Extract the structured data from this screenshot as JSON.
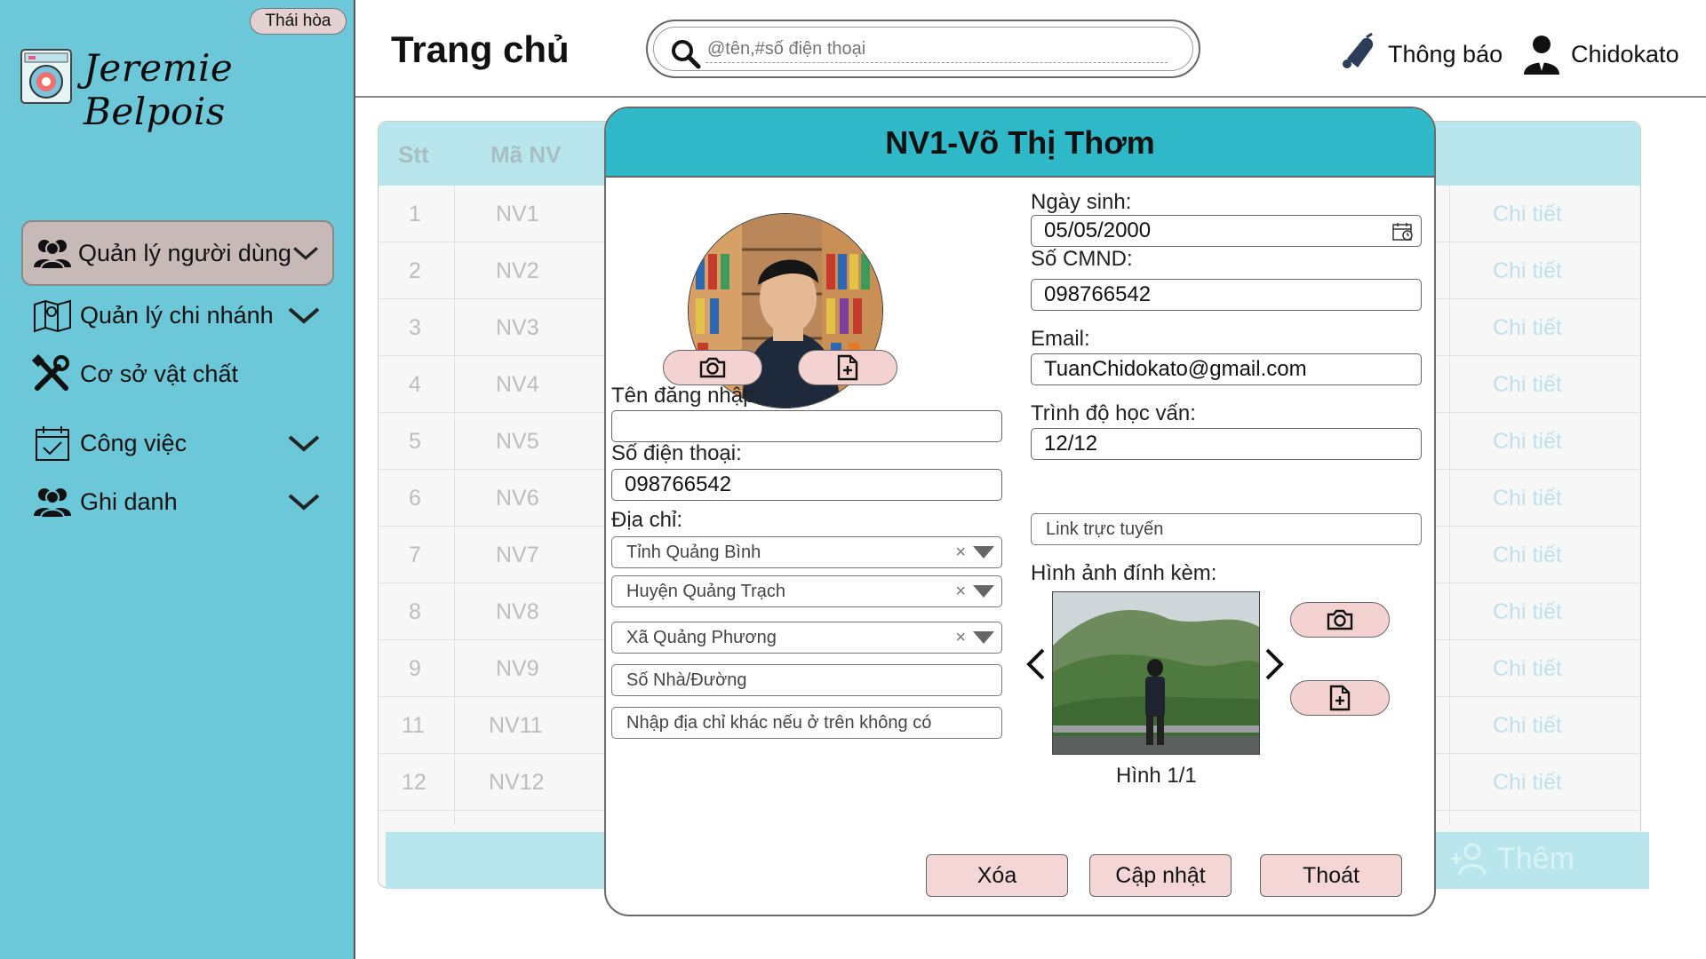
{
  "sidebar": {
    "branch_badge": "Thái hòa",
    "brand_name": "Jeremie Belpois",
    "items": [
      {
        "label": "Quản lý người dùng",
        "icon": "users-icon",
        "active": true
      },
      {
        "label": "Quản lý chi nhánh",
        "icon": "map-icon",
        "active": false
      },
      {
        "label": "Cơ sở vật chất",
        "icon": "tools-icon",
        "active": false
      },
      {
        "label": "Công việc",
        "icon": "calendar-check-icon",
        "active": false
      },
      {
        "label": "Ghi danh",
        "icon": "users-icon",
        "active": false
      }
    ]
  },
  "header": {
    "title": "Trang chủ",
    "search_placeholder": "@tên,#số điện thoại",
    "notifications_label": "Thông báo",
    "user_name": "Chidokato"
  },
  "table": {
    "columns": [
      "Stt",
      "Mã NV"
    ],
    "detail_label": "Chi tiết",
    "rows": [
      {
        "stt": "1",
        "code": "NV1"
      },
      {
        "stt": "2",
        "code": "NV2"
      },
      {
        "stt": "3",
        "code": "NV3"
      },
      {
        "stt": "4",
        "code": "NV4"
      },
      {
        "stt": "5",
        "code": "NV5"
      },
      {
        "stt": "6",
        "code": "NV6"
      },
      {
        "stt": "7",
        "code": "NV7"
      },
      {
        "stt": "8",
        "code": "NV8"
      },
      {
        "stt": "9",
        "code": "NV9"
      },
      {
        "stt": "11",
        "code": "NV11"
      },
      {
        "stt": "12",
        "code": "NV12"
      }
    ],
    "add_label": "Thêm"
  },
  "modal": {
    "title": "NV1-Võ Thị Thơm",
    "username_label": "Tên đăng nhập:",
    "username_value": "",
    "phone_label": "Số điện thoại:",
    "phone_value": "098766542",
    "address_label": "Địa chỉ:",
    "province": "Tỉnh Quảng Bình",
    "district": "Huyện Quảng Trạch",
    "ward": "Xã Quảng Phương",
    "street_placeholder": "Số Nhà/Đường",
    "other_address_placeholder": "Nhập địa chỉ khác nếu ở trên không có",
    "dob_label": "Ngày sinh:",
    "dob_value": "05/05/2000",
    "id_label": "Số CMND:",
    "id_value": "098766542",
    "email_label": "Email:",
    "email_value": "TuanChidokato@gmail.com",
    "education_label": "Trình độ học vấn:",
    "education_value": "12/12",
    "online_link_placeholder": "Link trực tuyến",
    "attachments_label": "Hình ảnh đính kèm:",
    "image_counter": "Hình 1/1",
    "delete_label": "Xóa",
    "update_label": "Cập nhật",
    "exit_label": "Thoát"
  },
  "colors": {
    "sidebar_bg": "#6cc8d8",
    "modal_header": "#2fb8c8",
    "button_pink": "#f4d6d6",
    "table_header": "#b9e6ec"
  }
}
